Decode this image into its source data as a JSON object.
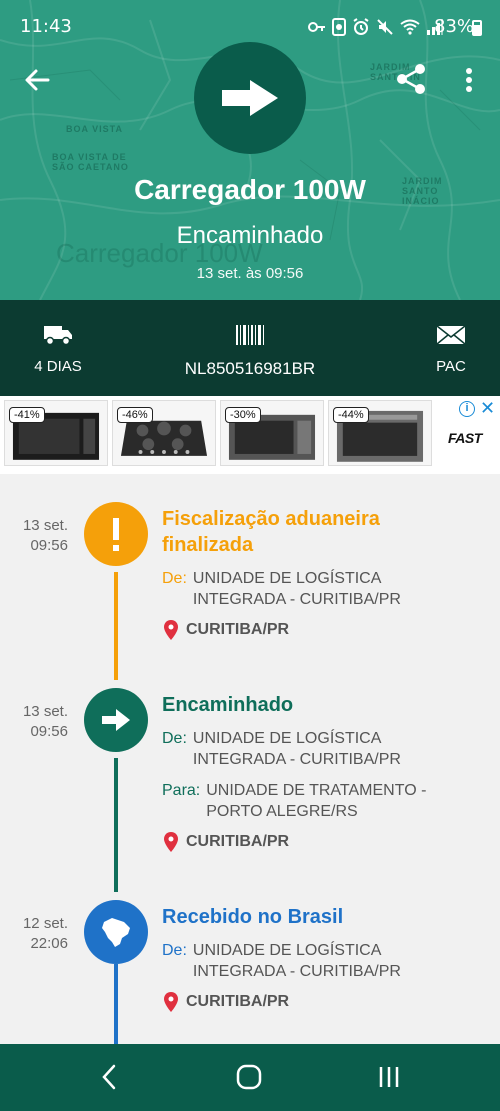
{
  "status_bar": {
    "time": "11:43",
    "battery": "83%"
  },
  "header": {
    "title": "Carregador 100W",
    "status": "Encaminhado",
    "datetime": "13 set. às 09:56",
    "bg_title": "Carregador 100W",
    "map_labels": [
      "BOA VISTA DE SÃO CAETANO",
      "BOA VISTA",
      "JARDIM SANTO IN",
      "JARDIM SANTO INÁCIO"
    ],
    "background_color": "#2e9c82",
    "icon": "arrow-right-icon"
  },
  "info_bar": {
    "days": "4 DIAS",
    "tracking_code": "NL850516981BR",
    "service": "PAC"
  },
  "ad": {
    "discounts": [
      "-41%",
      "-46%",
      "-30%",
      "-44%"
    ],
    "brand": "FAST"
  },
  "events": [
    {
      "date": "13 set.",
      "time": "09:56",
      "title": "Fiscalização aduaneira finalizada",
      "color": "#f5a00a",
      "icon": "exclamation-icon",
      "from_label": "De:",
      "from": "UNIDADE DE LOGÍSTICA INTEGRADA - CURITIBA/PR",
      "location": "CURITIBA/PR"
    },
    {
      "date": "13 set.",
      "time": "09:56",
      "title": "Encaminhado",
      "color": "#0f6e5a",
      "icon": "arrow-right-icon",
      "from_label": "De:",
      "from": "UNIDADE DE LOGÍSTICA INTEGRADA - CURITIBA/PR",
      "to_label": "Para:",
      "to": "UNIDADE DE TRATAMENTO - PORTO ALEGRE/RS",
      "location": "CURITIBA/PR"
    },
    {
      "date": "12 set.",
      "time": "22:06",
      "title": "Recebido no Brasil",
      "color": "#1f72c8",
      "icon": "brazil-map-icon",
      "from_label": "De:",
      "from": "UNIDADE DE LOGÍSTICA INTEGRADA - CURITIBA/PR",
      "location": "CURITIBA/PR"
    }
  ],
  "colors": {
    "nav_bar": "#0a5c4b",
    "info_bar": "#0c3b31",
    "pin": "#e0303f"
  }
}
